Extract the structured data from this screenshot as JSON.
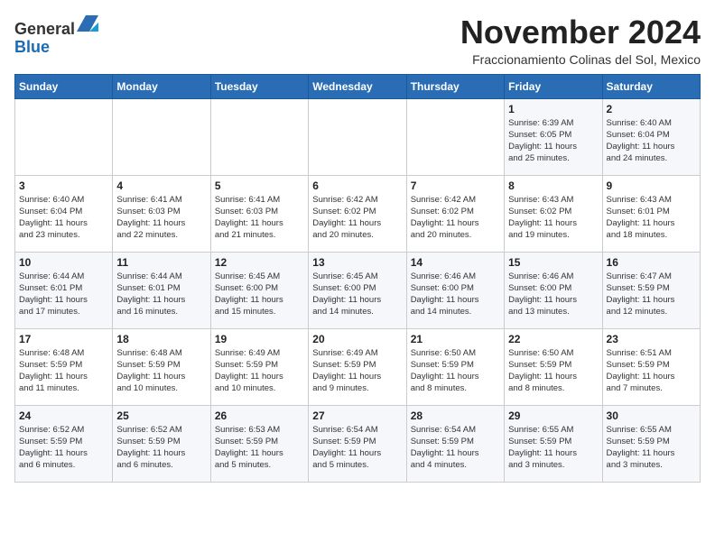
{
  "header": {
    "logo_line1": "General",
    "logo_line2": "Blue",
    "month": "November 2024",
    "subtitle": "Fraccionamiento Colinas del Sol, Mexico"
  },
  "days_of_week": [
    "Sunday",
    "Monday",
    "Tuesday",
    "Wednesday",
    "Thursday",
    "Friday",
    "Saturday"
  ],
  "weeks": [
    [
      {
        "day": "",
        "info": ""
      },
      {
        "day": "",
        "info": ""
      },
      {
        "day": "",
        "info": ""
      },
      {
        "day": "",
        "info": ""
      },
      {
        "day": "",
        "info": ""
      },
      {
        "day": "1",
        "info": "Sunrise: 6:39 AM\nSunset: 6:05 PM\nDaylight: 11 hours\nand 25 minutes."
      },
      {
        "day": "2",
        "info": "Sunrise: 6:40 AM\nSunset: 6:04 PM\nDaylight: 11 hours\nand 24 minutes."
      }
    ],
    [
      {
        "day": "3",
        "info": "Sunrise: 6:40 AM\nSunset: 6:04 PM\nDaylight: 11 hours\nand 23 minutes."
      },
      {
        "day": "4",
        "info": "Sunrise: 6:41 AM\nSunset: 6:03 PM\nDaylight: 11 hours\nand 22 minutes."
      },
      {
        "day": "5",
        "info": "Sunrise: 6:41 AM\nSunset: 6:03 PM\nDaylight: 11 hours\nand 21 minutes."
      },
      {
        "day": "6",
        "info": "Sunrise: 6:42 AM\nSunset: 6:02 PM\nDaylight: 11 hours\nand 20 minutes."
      },
      {
        "day": "7",
        "info": "Sunrise: 6:42 AM\nSunset: 6:02 PM\nDaylight: 11 hours\nand 20 minutes."
      },
      {
        "day": "8",
        "info": "Sunrise: 6:43 AM\nSunset: 6:02 PM\nDaylight: 11 hours\nand 19 minutes."
      },
      {
        "day": "9",
        "info": "Sunrise: 6:43 AM\nSunset: 6:01 PM\nDaylight: 11 hours\nand 18 minutes."
      }
    ],
    [
      {
        "day": "10",
        "info": "Sunrise: 6:44 AM\nSunset: 6:01 PM\nDaylight: 11 hours\nand 17 minutes."
      },
      {
        "day": "11",
        "info": "Sunrise: 6:44 AM\nSunset: 6:01 PM\nDaylight: 11 hours\nand 16 minutes."
      },
      {
        "day": "12",
        "info": "Sunrise: 6:45 AM\nSunset: 6:00 PM\nDaylight: 11 hours\nand 15 minutes."
      },
      {
        "day": "13",
        "info": "Sunrise: 6:45 AM\nSunset: 6:00 PM\nDaylight: 11 hours\nand 14 minutes."
      },
      {
        "day": "14",
        "info": "Sunrise: 6:46 AM\nSunset: 6:00 PM\nDaylight: 11 hours\nand 14 minutes."
      },
      {
        "day": "15",
        "info": "Sunrise: 6:46 AM\nSunset: 6:00 PM\nDaylight: 11 hours\nand 13 minutes."
      },
      {
        "day": "16",
        "info": "Sunrise: 6:47 AM\nSunset: 5:59 PM\nDaylight: 11 hours\nand 12 minutes."
      }
    ],
    [
      {
        "day": "17",
        "info": "Sunrise: 6:48 AM\nSunset: 5:59 PM\nDaylight: 11 hours\nand 11 minutes."
      },
      {
        "day": "18",
        "info": "Sunrise: 6:48 AM\nSunset: 5:59 PM\nDaylight: 11 hours\nand 10 minutes."
      },
      {
        "day": "19",
        "info": "Sunrise: 6:49 AM\nSunset: 5:59 PM\nDaylight: 11 hours\nand 10 minutes."
      },
      {
        "day": "20",
        "info": "Sunrise: 6:49 AM\nSunset: 5:59 PM\nDaylight: 11 hours\nand 9 minutes."
      },
      {
        "day": "21",
        "info": "Sunrise: 6:50 AM\nSunset: 5:59 PM\nDaylight: 11 hours\nand 8 minutes."
      },
      {
        "day": "22",
        "info": "Sunrise: 6:50 AM\nSunset: 5:59 PM\nDaylight: 11 hours\nand 8 minutes."
      },
      {
        "day": "23",
        "info": "Sunrise: 6:51 AM\nSunset: 5:59 PM\nDaylight: 11 hours\nand 7 minutes."
      }
    ],
    [
      {
        "day": "24",
        "info": "Sunrise: 6:52 AM\nSunset: 5:59 PM\nDaylight: 11 hours\nand 6 minutes."
      },
      {
        "day": "25",
        "info": "Sunrise: 6:52 AM\nSunset: 5:59 PM\nDaylight: 11 hours\nand 6 minutes."
      },
      {
        "day": "26",
        "info": "Sunrise: 6:53 AM\nSunset: 5:59 PM\nDaylight: 11 hours\nand 5 minutes."
      },
      {
        "day": "27",
        "info": "Sunrise: 6:54 AM\nSunset: 5:59 PM\nDaylight: 11 hours\nand 5 minutes."
      },
      {
        "day": "28",
        "info": "Sunrise: 6:54 AM\nSunset: 5:59 PM\nDaylight: 11 hours\nand 4 minutes."
      },
      {
        "day": "29",
        "info": "Sunrise: 6:55 AM\nSunset: 5:59 PM\nDaylight: 11 hours\nand 3 minutes."
      },
      {
        "day": "30",
        "info": "Sunrise: 6:55 AM\nSunset: 5:59 PM\nDaylight: 11 hours\nand 3 minutes."
      }
    ]
  ]
}
